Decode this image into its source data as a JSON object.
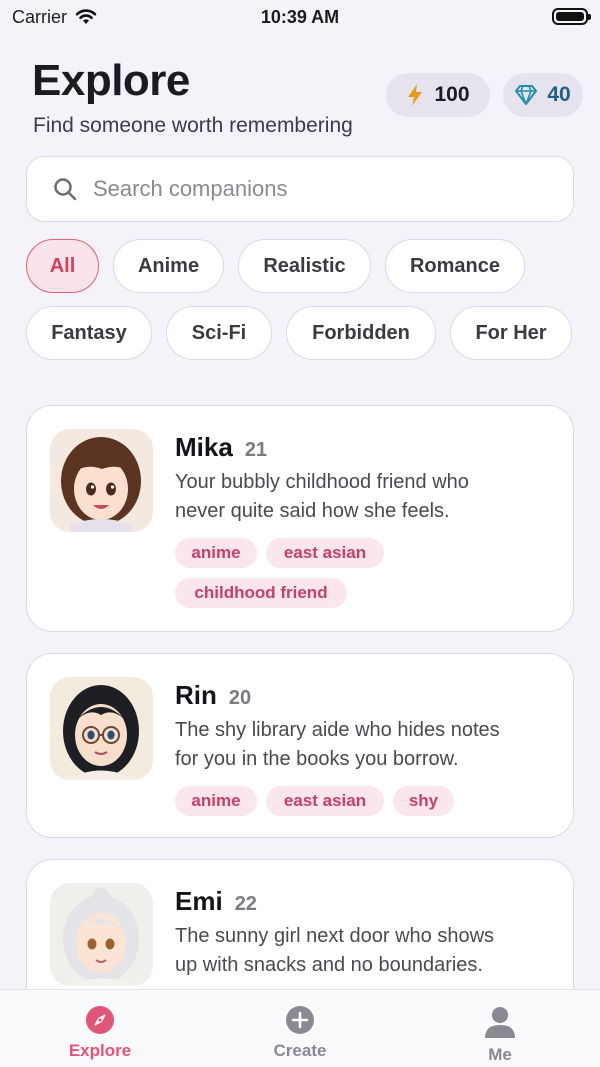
{
  "status_bar": {
    "carrier": "Carrier",
    "time": "10:39 AM"
  },
  "header": {
    "title": "Explore",
    "subtitle": "Find someone worth remembering",
    "energy": {
      "value": "100",
      "icon": "lightning-icon",
      "color": "#e89a1f"
    },
    "gems": {
      "value": "40",
      "icon": "gem-icon",
      "color": "#1f8fb0"
    }
  },
  "search": {
    "placeholder": "Search companions"
  },
  "filters": [
    "All",
    "Anime",
    "Realistic",
    "Romance",
    "Fantasy",
    "Sci-Fi",
    "Forbidden",
    "For Her"
  ],
  "active_filter": "All",
  "companions": [
    {
      "name": "Mika",
      "age": "21",
      "description_lines": [
        "Your bubbly childhood friend who",
        "never quite said how she feels."
      ],
      "tags": [
        "anime",
        "east asian",
        "childhood friend"
      ]
    },
    {
      "name": "Rin",
      "age": "20",
      "description_lines": [
        "The shy library aide who hides notes",
        "for you in the books you borrow."
      ],
      "tags": [
        "anime",
        "east asian",
        "shy"
      ]
    },
    {
      "name": "Emi",
      "age": "22",
      "description_lines": [
        "The sunny girl next door who shows",
        "up with snacks and no boundaries."
      ],
      "tags": []
    }
  ],
  "tabs": [
    {
      "label": "Explore",
      "icon": "compass-icon",
      "active": true
    },
    {
      "label": "Create",
      "icon": "plus-circle-icon",
      "active": false
    },
    {
      "label": "Me",
      "icon": "person-icon",
      "active": false
    }
  ],
  "colors": {
    "accent": "#e05578",
    "inactive": "#8a8893",
    "tag_text": "#c7406a",
    "tag_bg": "#fbe6ed"
  }
}
